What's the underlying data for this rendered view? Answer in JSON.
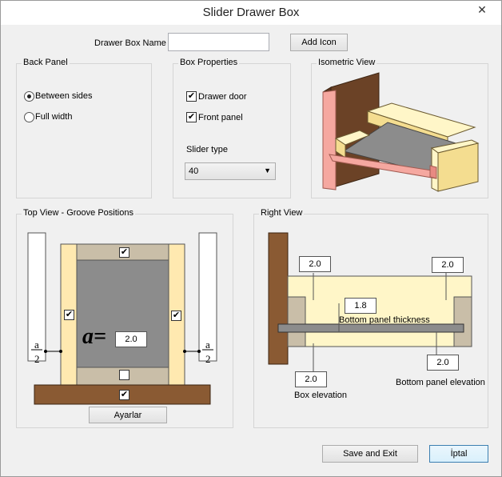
{
  "window": {
    "title": "Slider Drawer Box",
    "close_icon": "close-icon"
  },
  "name_row": {
    "label": "Drawer Box Name",
    "value": "",
    "add_icon_button": "Add Icon"
  },
  "back_panel": {
    "title": "Back Panel",
    "options": [
      {
        "label": "Between sides",
        "selected": true
      },
      {
        "label": "Full width",
        "selected": false
      }
    ]
  },
  "box_properties": {
    "title": "Box Properties",
    "drawer_door": {
      "label": "Drawer door",
      "checked": true
    },
    "front_panel": {
      "label": "Front panel",
      "checked": true
    },
    "slider_type_label": "Slider type",
    "slider_type_value": "40"
  },
  "isometric_view": {
    "title": "Isometric View"
  },
  "top_view": {
    "title": "Top View - Groove Positions",
    "a_symbol": "a=",
    "a_value": "2.0",
    "fraction_num": "a",
    "fraction_den": "2",
    "button": "Ayarlar"
  },
  "right_view": {
    "title": "Right View",
    "dim_top_left": "2.0",
    "dim_top_right": "2.0",
    "bottom_panel_thickness_value": "1.8",
    "bottom_panel_thickness_label": "Bottom panel thickness",
    "box_elevation_value": "2.0",
    "box_elevation_label": "Box elevation",
    "bottom_panel_elevation_value": "2.0",
    "bottom_panel_elevation_label": "Bottom panel elevation"
  },
  "footer": {
    "save_button": "Save and Exit",
    "cancel_button": "İptal"
  },
  "colors": {
    "wood": "#8a5a33",
    "panel_face": "#fff6c8",
    "panel_edge": "#e8c98a",
    "pink": "#f5a8a0",
    "grey": "#8c8c8c"
  }
}
